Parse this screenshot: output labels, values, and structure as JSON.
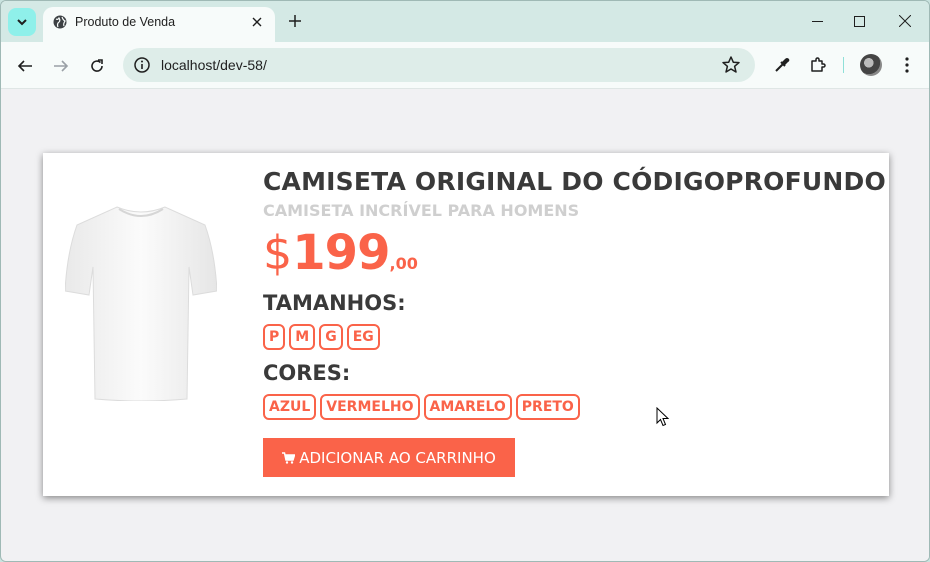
{
  "browser": {
    "tab_title": "Produto de Venda",
    "url": "localhost/dev-58/"
  },
  "product": {
    "title": "CAMISETA ORIGINAL DO CÓDIGOPROFUNDO",
    "subtitle": "CAMISETA INCRÍVEL PARA HOMENS",
    "price_currency": "$",
    "price_integer": "199",
    "price_decimal": ",00",
    "sizes_label": "TAMANHOS:",
    "sizes": [
      "P",
      "M",
      "G",
      "EG"
    ],
    "colors_label": "CORES:",
    "colors": [
      "AZUL",
      "VERMELHO",
      "AMARELO",
      "PRETO"
    ],
    "add_to_cart_label": "ADICIONAR AO CARRINHO"
  },
  "colors": {
    "accent": "#fa6349",
    "heading": "#3a3a3a",
    "subtitle": "#cfcfcf",
    "page_bg": "#f1f1f3",
    "tab_strip": "#d4e9e5"
  },
  "icons": [
    "tab-search-icon",
    "globe-icon",
    "close-icon",
    "plus-icon",
    "minimize-icon",
    "maximize-icon",
    "back-icon",
    "forward-icon",
    "reload-icon",
    "info-icon",
    "star-icon",
    "eyedropper-icon",
    "extensions-icon",
    "menu-icon",
    "cart-icon",
    "tshirt-image",
    "mouse-cursor-icon"
  ]
}
